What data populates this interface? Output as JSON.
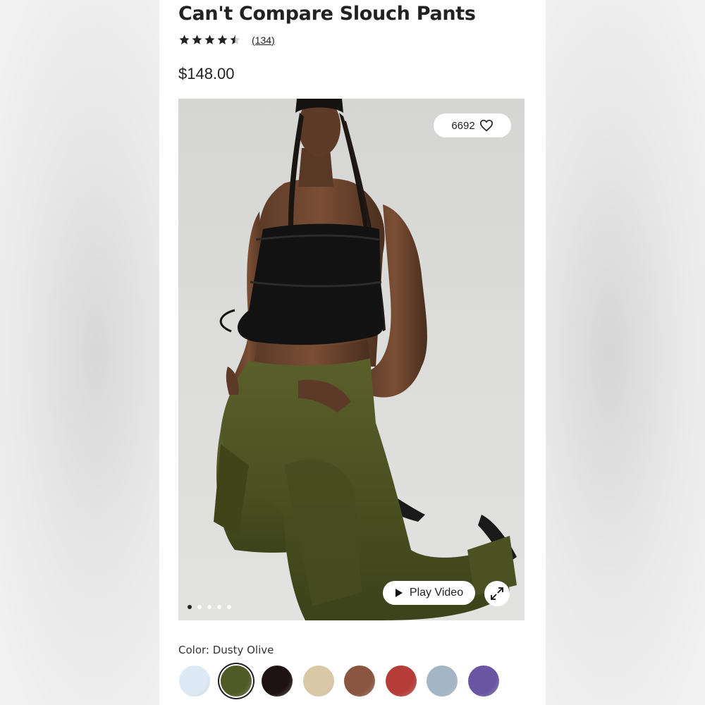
{
  "product": {
    "title": "Can't Compare Slouch Pants",
    "rating": 4.5,
    "review_count": "(134)",
    "price": "$148.00"
  },
  "media": {
    "favorites_count": "6692",
    "play_video_label": "Play Video",
    "image_count": 5,
    "active_image_index": 0
  },
  "color": {
    "label": "Color: Dusty Olive",
    "selected_index": 1,
    "swatches": [
      {
        "name": "light-blue",
        "hex": "#dde9f4"
      },
      {
        "name": "dusty-olive",
        "hex": "#4f5a25"
      },
      {
        "name": "black-brown",
        "hex": "#1e1212"
      },
      {
        "name": "tan",
        "hex": "#d9c8a6"
      },
      {
        "name": "brown",
        "hex": "#8a5642"
      },
      {
        "name": "red",
        "hex": "#b63c3a"
      },
      {
        "name": "grey-blue",
        "hex": "#a4b6c6"
      },
      {
        "name": "purple",
        "hex": "#6a55a3"
      }
    ]
  },
  "colors": {
    "text": "#222222",
    "panel_bg": "#ffffff",
    "page_bg": "#eeeeee"
  }
}
